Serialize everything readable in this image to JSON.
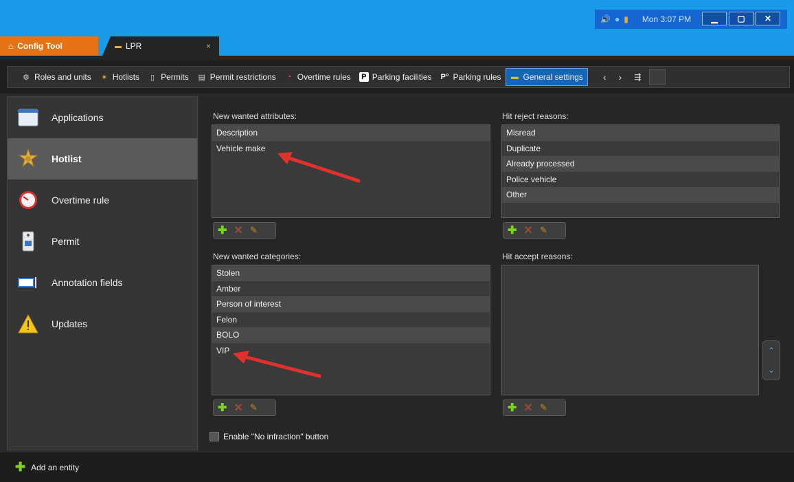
{
  "tray": {
    "time": "Mon 3:07 PM"
  },
  "tabs": [
    {
      "label": "Config Tool"
    },
    {
      "label": "LPR",
      "close": "×"
    }
  ],
  "toolbar": {
    "items": [
      {
        "label": "Roles and units"
      },
      {
        "label": "Hotlists"
      },
      {
        "label": "Permits"
      },
      {
        "label": "Permit restrictions"
      },
      {
        "label": "Overtime rules"
      },
      {
        "label": "Parking facilities"
      },
      {
        "label": "Parking rules"
      },
      {
        "label": "General settings"
      }
    ]
  },
  "sidebar": {
    "items": [
      {
        "label": "Applications"
      },
      {
        "label": "Hotlist"
      },
      {
        "label": "Overtime rule"
      },
      {
        "label": "Permit"
      },
      {
        "label": "Annotation fields"
      },
      {
        "label": "Updates"
      }
    ]
  },
  "main": {
    "wanted_attributes": {
      "label": "New wanted attributes:",
      "items": [
        "Description",
        "Vehicle make"
      ]
    },
    "reject_reasons": {
      "label": "Hit reject reasons:",
      "items": [
        "Misread",
        "Duplicate",
        "Already processed",
        "Police vehicle",
        "Other"
      ]
    },
    "wanted_categories": {
      "label": "New wanted categories:",
      "items": [
        "Stolen",
        "Amber",
        "Person of interest",
        "Felon",
        "BOLO",
        "VIP"
      ]
    },
    "accept_reasons": {
      "label": "Hit accept reasons:",
      "items": []
    },
    "no_infraction_label": "Enable \"No infraction\" button"
  },
  "bottombar": {
    "add_label": "Add an entity"
  },
  "colors": {
    "accent_blue": "#1565b8",
    "config_orange": "#e57316",
    "add_green": "#7ed321",
    "arrow_red": "#e0322c"
  }
}
